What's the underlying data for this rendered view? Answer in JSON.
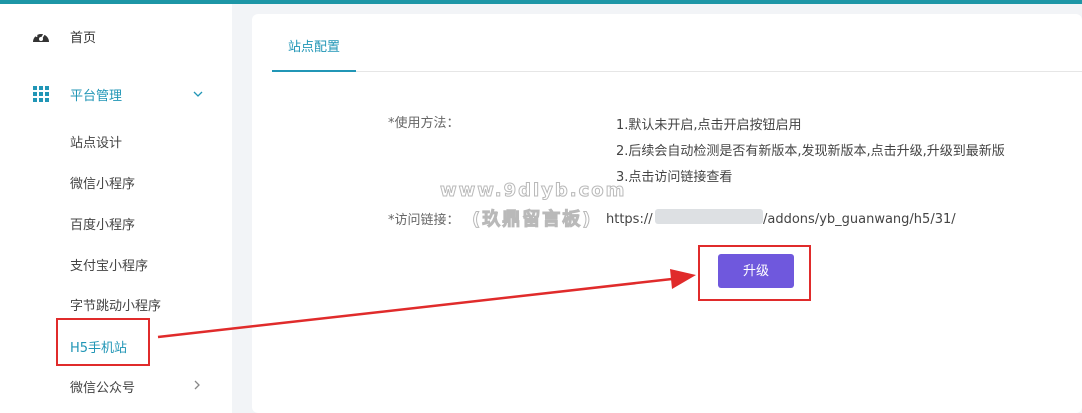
{
  "sidebar": {
    "home": {
      "label": "首页",
      "icon": "dashboard-icon"
    },
    "platform": {
      "label": "平台管理",
      "icon": "grid-icon",
      "expanded": true
    },
    "sub_items": [
      {
        "label": "站点设计"
      },
      {
        "label": "微信小程序"
      },
      {
        "label": "百度小程序"
      },
      {
        "label": "支付宝小程序"
      },
      {
        "label": "字节跳动小程序"
      },
      {
        "label": "H5手机站",
        "active": true
      },
      {
        "label": "微信公众号"
      }
    ]
  },
  "tabs": [
    {
      "label": "站点配置",
      "active": true
    }
  ],
  "form": {
    "usage_label": "*使用方法：",
    "usage_lines": [
      "1.默认未开启,点击开启按钮启用",
      "2.后续会自动检测是否有新版本,发现新版本,点击升级,升级到最新版",
      "3.点击访问链接查看"
    ],
    "link_label": "*访问链接：",
    "link_prefix": "https://",
    "link_suffix": "/addons/yb_guanwang/h5/31/"
  },
  "upgrade_button": "升级",
  "watermark": {
    "line1": "www.9dlyb.com",
    "line2": "(玖鼎留言板)"
  },
  "colors": {
    "accent": "#2196b6",
    "button": "#6f58dd",
    "highlight": "#e02b2b"
  }
}
